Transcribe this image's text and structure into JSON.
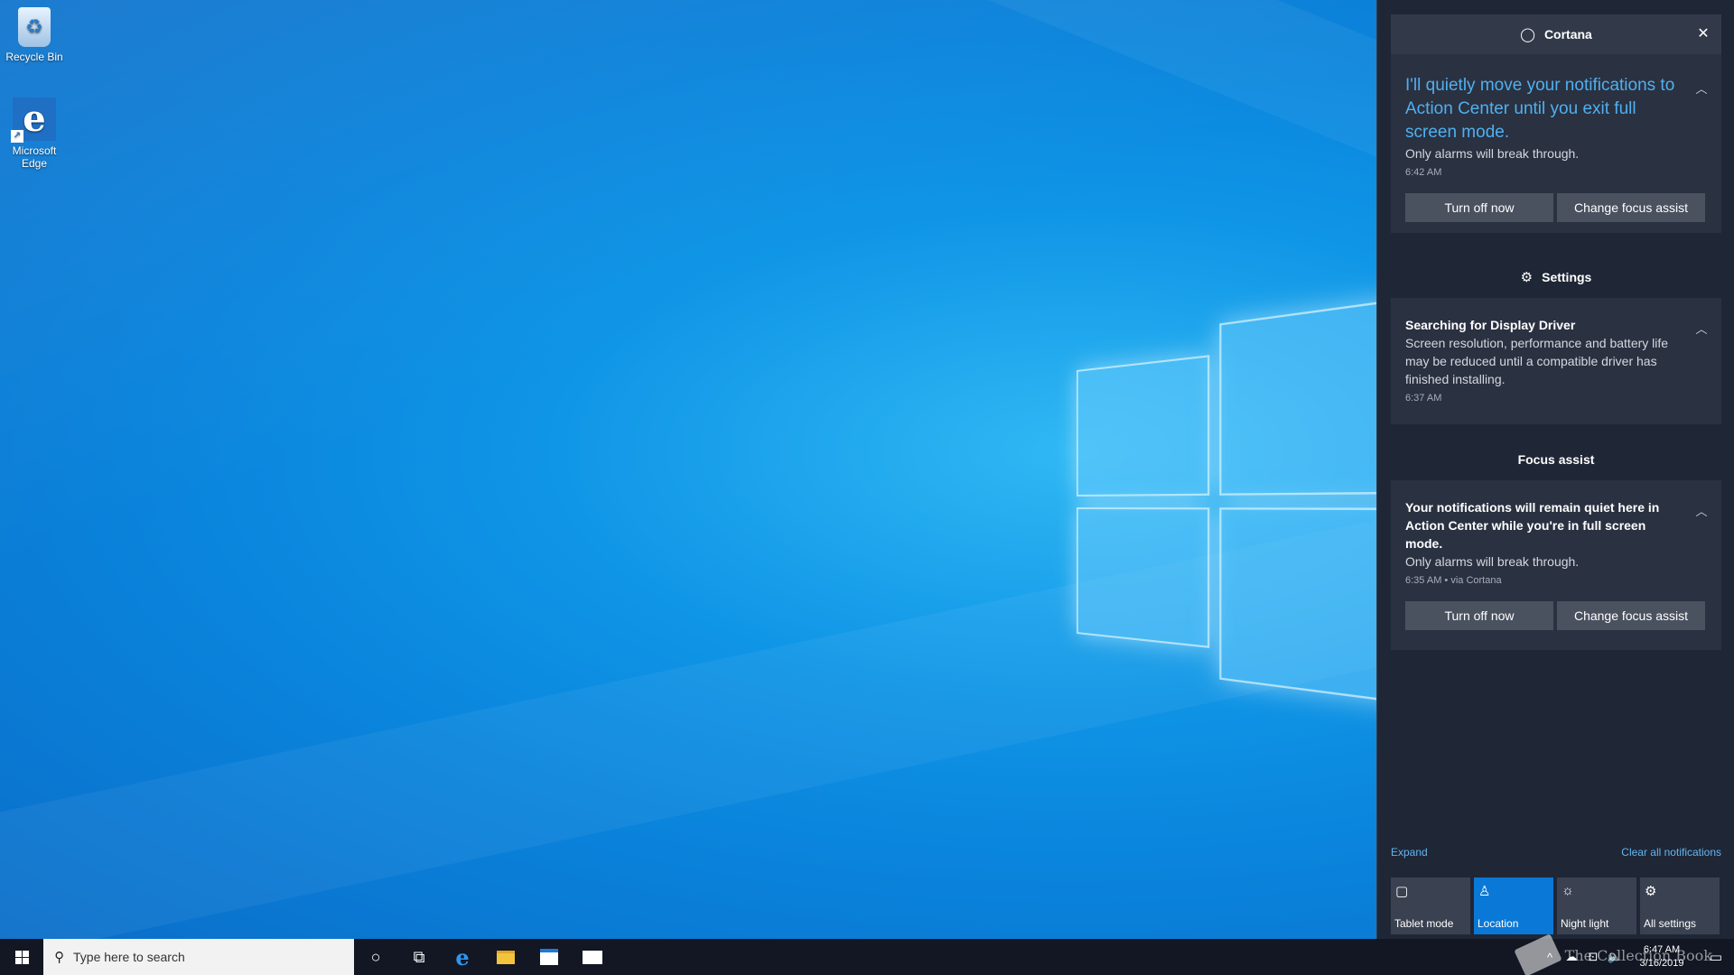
{
  "desktop": {
    "icons": [
      {
        "label": "Recycle Bin",
        "icon": "recycle-bin-icon"
      },
      {
        "label": "Microsoft Edge",
        "icon": "edge-icon"
      }
    ]
  },
  "action_center": {
    "cortana_group": {
      "title": "Cortana",
      "icon": "cortana-circle-icon",
      "close_glyph": "✕",
      "notification": {
        "title": "I'll quietly move your notifications to Action Center until you exit full screen mode.",
        "body": "Only alarms will break through.",
        "time": "6:42 AM",
        "buttons": [
          "Turn off now",
          "Change focus assist"
        ]
      }
    },
    "settings_group": {
      "title": "Settings",
      "icon": "gear-icon",
      "notification": {
        "title": "Searching for Display Driver",
        "body": "Screen resolution, performance and battery life may be reduced until a compatible driver has finished installing.",
        "time": "6:37 AM"
      }
    },
    "focus_group": {
      "title": "Focus assist",
      "notification": {
        "title": "Your notifications will remain quiet here in Action Center while you're in full screen mode.",
        "body": "Only alarms will break through.",
        "time": "6:35 AM • via Cortana",
        "buttons": [
          "Turn off now",
          "Change focus assist"
        ]
      }
    },
    "expand_label": "Expand",
    "clear_label": "Clear all notifications",
    "quick_actions": [
      {
        "label": "Tablet mode",
        "icon": "tablet-mode-icon",
        "active": false
      },
      {
        "label": "Location",
        "icon": "location-icon",
        "active": true
      },
      {
        "label": "Night light",
        "icon": "night-light-icon",
        "active": false
      },
      {
        "label": "All settings",
        "icon": "gear-icon",
        "active": false
      }
    ],
    "accent_color": "#0a78d7",
    "link_color": "#62b5f2"
  },
  "taskbar": {
    "search_placeholder": "Type here to search",
    "clock_time": "6:47 AM",
    "clock_date": "3/16/2019"
  },
  "watermark": "The Collection Book"
}
